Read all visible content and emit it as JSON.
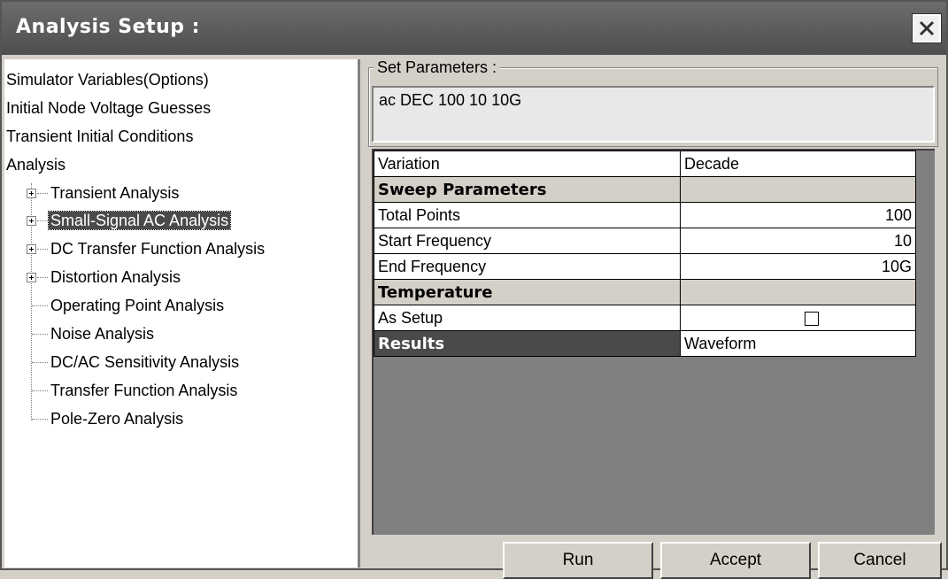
{
  "window": {
    "title": "Analysis Setup  :"
  },
  "tree": {
    "items": [
      {
        "label": "Simulator Variables(Options)"
      },
      {
        "label": "Initial Node Voltage Guesses"
      },
      {
        "label": "Transient Initial Conditions"
      },
      {
        "label": "Analysis"
      },
      {
        "label": "Transient Analysis",
        "expandable": true
      },
      {
        "label": "Small-Signal AC Analysis",
        "expandable": true,
        "selected": true
      },
      {
        "label": "DC Transfer Function Analysis",
        "expandable": true
      },
      {
        "label": "Distortion Analysis",
        "expandable": true
      },
      {
        "label": "Operating Point Analysis"
      },
      {
        "label": "Noise Analysis"
      },
      {
        "label": "DC/AC Sensitivity Analysis"
      },
      {
        "label": "Transfer Function Analysis"
      },
      {
        "label": "Pole-Zero Analysis"
      }
    ]
  },
  "params": {
    "legend": "Set Parameters  :",
    "command": "ac DEC  100 10 10G"
  },
  "grid": {
    "variation_label": "Variation",
    "variation_value": "Decade",
    "sweep_header": "Sweep Parameters",
    "total_points_label": "Total Points",
    "total_points_value": "100",
    "start_freq_label": "Start Frequency",
    "start_freq_value": "10",
    "end_freq_label": "End Frequency",
    "end_freq_value": "10G",
    "temperature_header": "Temperature",
    "as_setup_label": "As Setup",
    "as_setup_checked": false,
    "results_label": "Results",
    "results_value": "Waveform"
  },
  "buttons": {
    "run": "Run",
    "accept": "Accept",
    "cancel": "Cancel"
  },
  "colors": {
    "titlebar": "#5a5a5a",
    "selection": "#4a4a4a",
    "face": "#d4d0c8"
  }
}
